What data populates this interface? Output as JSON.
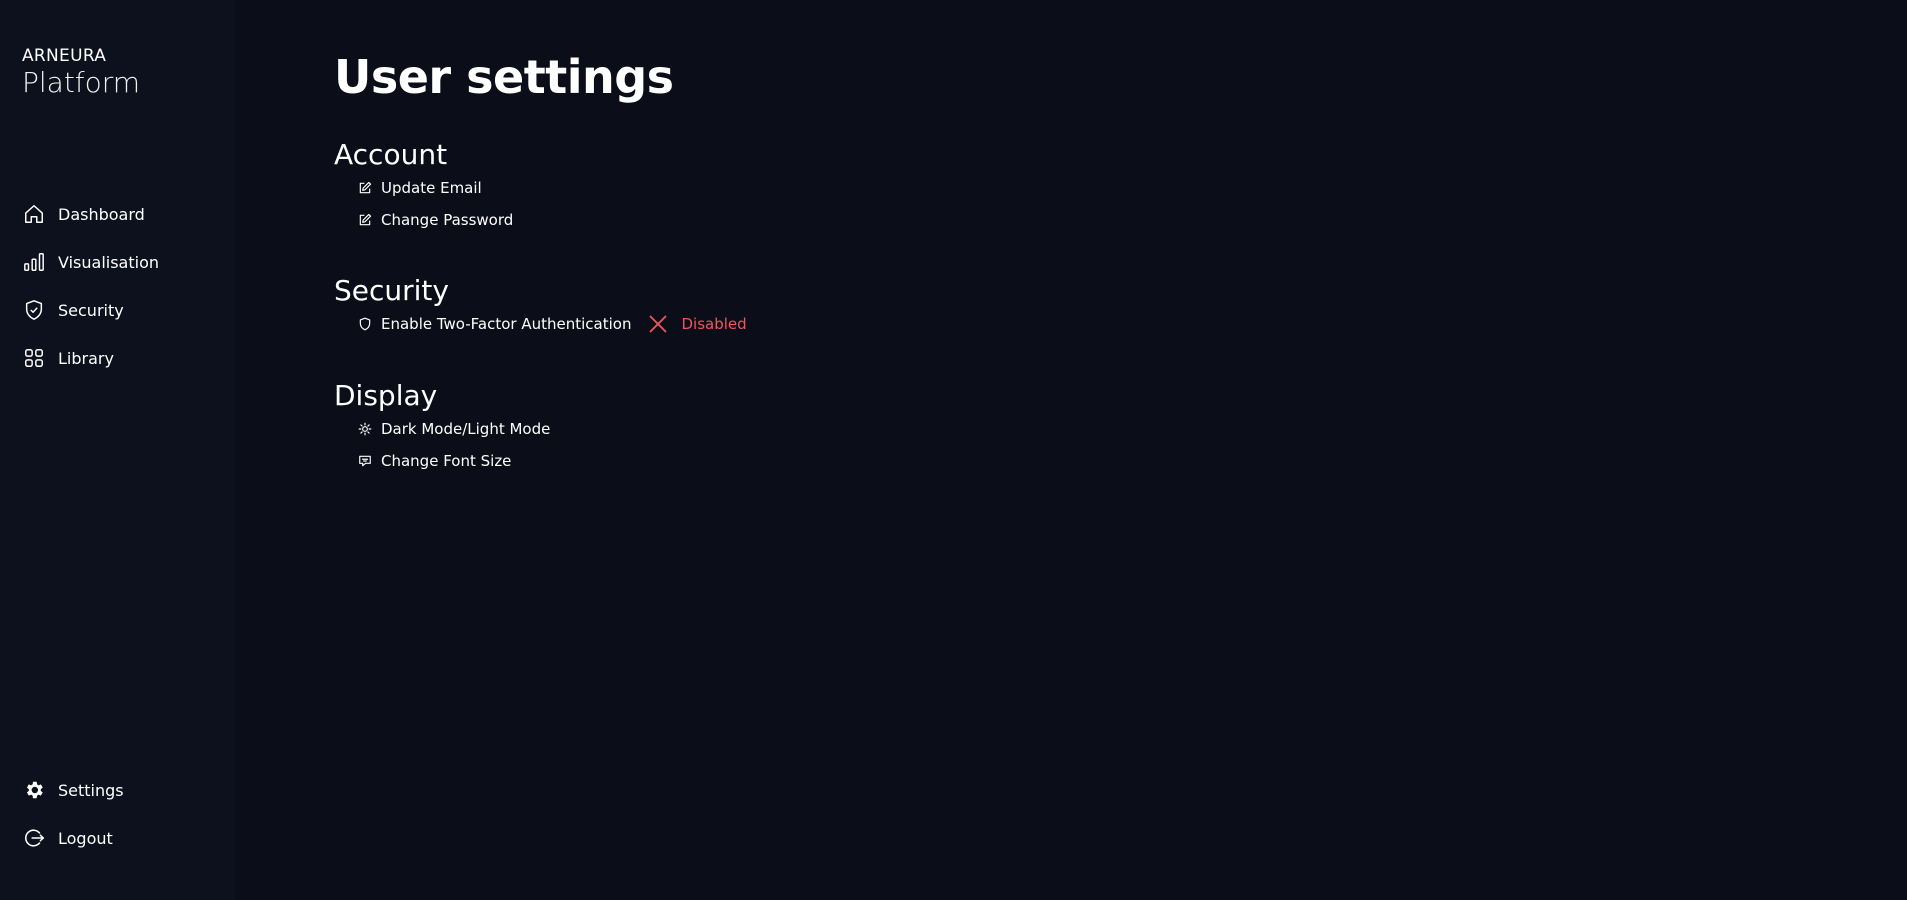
{
  "brand": {
    "name": "ARNEURA",
    "sub": "Platform"
  },
  "sidebar": {
    "items": [
      {
        "label": "Dashboard",
        "icon": "home-icon"
      },
      {
        "label": "Visualisation",
        "icon": "bar-chart-icon"
      },
      {
        "label": "Security",
        "icon": "shield-check-icon"
      },
      {
        "label": "Library",
        "icon": "grid-icon"
      }
    ],
    "bottom": [
      {
        "label": "Settings",
        "icon": "gear-icon"
      },
      {
        "label": "Logout",
        "icon": "logout-icon"
      }
    ]
  },
  "page": {
    "title": "User settings"
  },
  "sections": {
    "account": {
      "title": "Account",
      "options": [
        {
          "label": "Update Email",
          "icon": "edit-icon"
        },
        {
          "label": "Change Password",
          "icon": "edit-icon"
        }
      ]
    },
    "security": {
      "title": "Security",
      "options": [
        {
          "label": "Enable Two-Factor Authentication",
          "icon": "shield-icon",
          "status": "Disabled",
          "status_icon": "close-icon"
        }
      ]
    },
    "display": {
      "title": "Display",
      "options": [
        {
          "label": "Dark Mode/Light Mode",
          "icon": "sun-icon"
        },
        {
          "label": "Change Font Size",
          "icon": "message-icon"
        }
      ]
    }
  },
  "colors": {
    "background": "#0b0e18",
    "sidebar": "#0d111e",
    "text": "#ffffff",
    "danger": "#f0555f"
  }
}
